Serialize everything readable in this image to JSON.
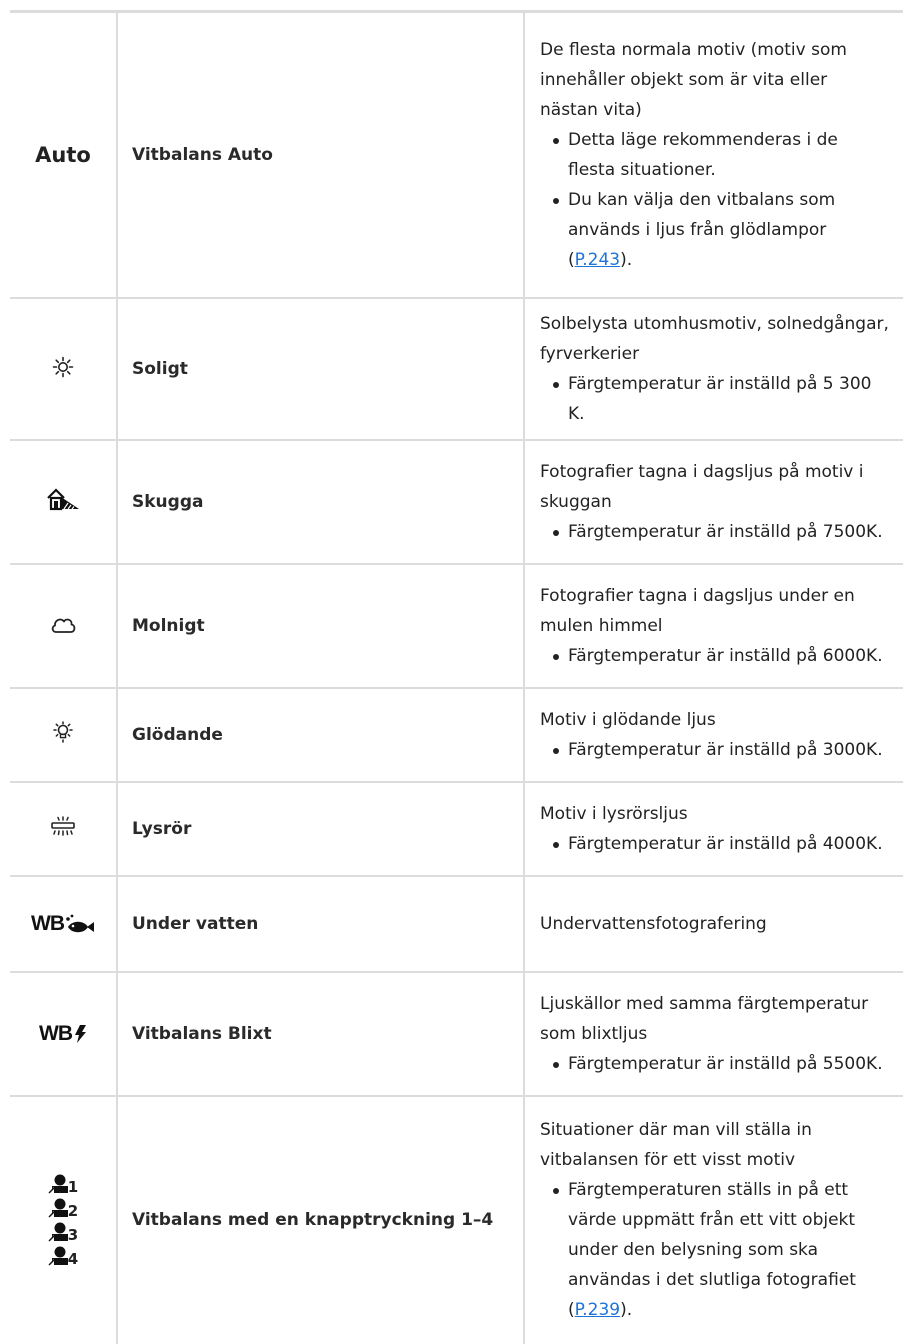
{
  "rows": [
    {
      "icon": "auto-text-icon",
      "icon_text": "Auto",
      "mode": "Vitbalans Auto",
      "description": "De flesta normala motiv (motiv som innehåller objekt som är vita eller nästan vita)",
      "bullets": [
        "Detta läge rekommenderas i de flesta situationer.",
        {
          "before": "Du kan välja den vitbalans som används i ljus från glödlampor (",
          "link": "P.243",
          "after": ")."
        }
      ]
    },
    {
      "icon": "sun-icon",
      "mode": "Soligt",
      "description": "Solbelysta utomhusmotiv, solnedgångar, fyrverkerier",
      "bullets": [
        "Färgtemperatur är inställd på 5 300 K."
      ]
    },
    {
      "icon": "shade-icon",
      "mode": "Skugga",
      "description": "Fotografier tagna i dagsljus på motiv i skuggan",
      "bullets": [
        "Färgtemperatur är inställd på 7500K."
      ]
    },
    {
      "icon": "cloud-icon",
      "mode": "Molnigt",
      "description": "Fotografier tagna i dagsljus under en mulen himmel",
      "bullets": [
        "Färgtemperatur är inställd på 6000K."
      ]
    },
    {
      "icon": "incandescent-icon",
      "mode": "Glödande",
      "description": "Motiv i glödande ljus",
      "bullets": [
        "Färgtemperatur är inställd på 3000K."
      ]
    },
    {
      "icon": "fluorescent-icon",
      "mode": "Lysrör",
      "description": "Motiv i lysrörsljus",
      "bullets": [
        "Färgtemperatur är inställd på 4000K."
      ]
    },
    {
      "icon": "underwater-wb-icon",
      "icon_text": "WB",
      "mode": "Under vatten",
      "description": "Undervattensfotografering",
      "bullets": []
    },
    {
      "icon": "flash-wb-icon",
      "icon_text": "WB",
      "mode": "Vitbalans Blixt",
      "description": "Ljuskällor med samma färgtemperatur som blixtljus",
      "bullets": [
        "Färgtemperatur är inställd på 5500K."
      ]
    },
    {
      "icon": "one-touch-wb-icon",
      "icon_numbers": [
        "1",
        "2",
        "3",
        "4"
      ],
      "mode": "Vitbalans med en knapptryckning 1–4",
      "description": "Situationer där man vill ställa in vitbalansen för ett visst motiv",
      "bullets": [
        {
          "before": "Färgtemperaturen ställs in på ett värde uppmätt från ett vitt objekt under den belysning som ska användas i det slutliga fotografiet (",
          "link": "P.239",
          "after": ")."
        }
      ]
    }
  ],
  "colors": {
    "border": "#dcdcdc",
    "text": "#222222",
    "link": "#1e73d8"
  }
}
